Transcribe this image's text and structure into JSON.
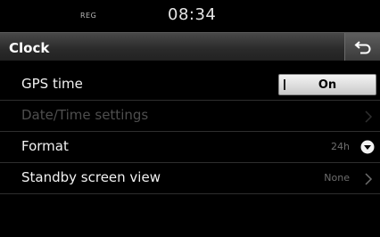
{
  "status_bar": {
    "badge": "REG",
    "time": "08:34"
  },
  "header": {
    "title": "Clock",
    "back_icon": "back-return-icon"
  },
  "settings": {
    "gps_time": {
      "label": "GPS time",
      "toggle_state": "On"
    },
    "date_time": {
      "label": "Date/Time settings",
      "enabled": false
    },
    "format": {
      "label": "Format",
      "value": "24h",
      "icon": "dropdown-circle-icon"
    },
    "standby_view": {
      "label": "Standby screen view",
      "value": "None",
      "icon": "chevron-right-icon"
    }
  },
  "colors": {
    "background": "#000000",
    "text": "#f2f2f2",
    "disabled_text": "#4e4e4e",
    "value_text": "#6e6e6e",
    "toggle_bg": "#e0e0e0"
  }
}
